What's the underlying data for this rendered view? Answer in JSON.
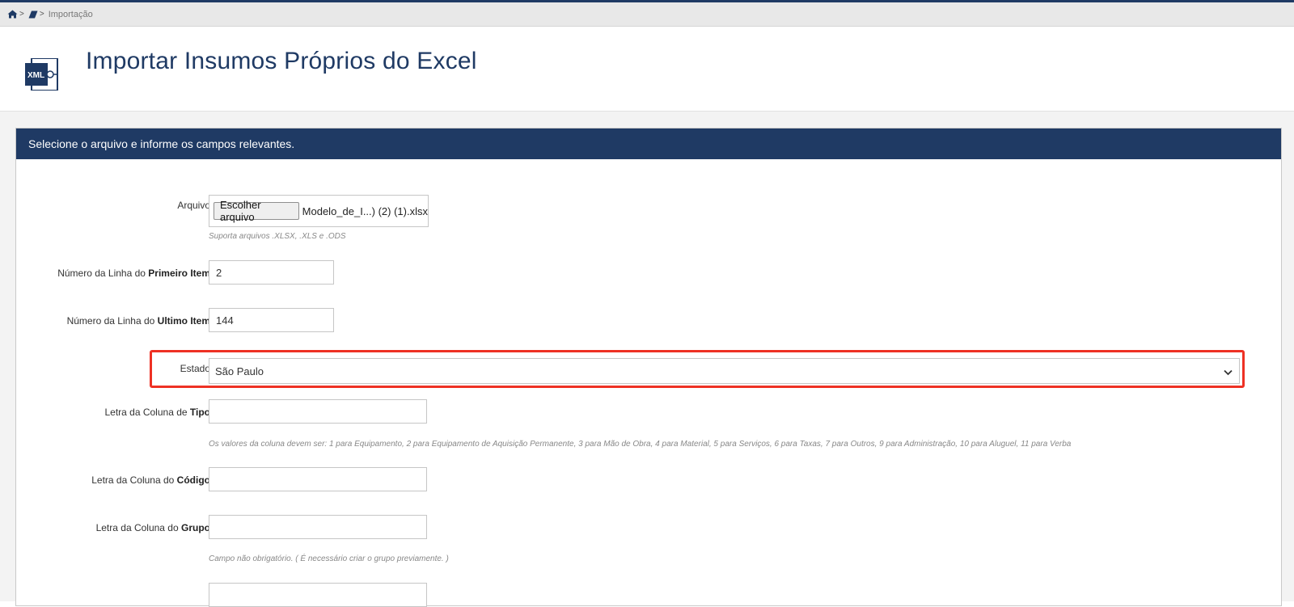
{
  "breadcrumb": {
    "current": "Importação"
  },
  "header": {
    "title": "Importar Insumos Próprios do Excel",
    "icon_label": "XML"
  },
  "panel": {
    "heading": "Selecione o arquivo e informe os campos relevantes.",
    "file": {
      "label": "Arquivo",
      "button": "Escolher arquivo",
      "filename": "Modelo_de_I...) (2) (1).xlsx",
      "help": "Suporta arquivos .XLSX, .XLS e .ODS"
    },
    "first_item": {
      "label_prefix": "Número da Linha do ",
      "label_bold": "Primeiro Item",
      "value": "2"
    },
    "last_item": {
      "label_prefix": "Número da Linha do ",
      "label_bold": "Ultimo Item",
      "value": "144"
    },
    "state": {
      "label": "Estado",
      "selected": "São Paulo"
    },
    "type_col": {
      "label_prefix": "Letra da Coluna de ",
      "label_bold": "Tipo",
      "value": "",
      "help": "Os valores da coluna devem ser: 1 para Equipamento, 2 para Equipamento de Aquisição Permanente, 3 para Mão de Obra, 4 para Material, 5 para Serviços, 6 para Taxas, 7 para Outros, 9 para Administração, 10 para Aluguel, 11 para Verba"
    },
    "code_col": {
      "label_prefix": "Letra da Coluna do ",
      "label_bold": "Código",
      "value": ""
    },
    "group_col": {
      "label_prefix": "Letra da Coluna do ",
      "label_bold": "Grupo",
      "value": "",
      "help": "Campo não obrigatório. ( É necessário criar o grupo previamente. )"
    }
  },
  "colors": {
    "navy": "#1f3a64",
    "highlight": "#ee3124"
  }
}
